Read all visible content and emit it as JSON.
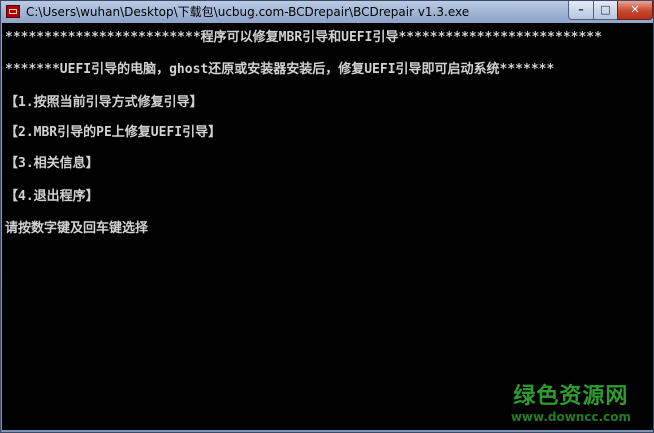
{
  "window": {
    "title": "C:\\Users\\wuhan\\Desktop\\下载包\\ucbug.com-BCDrepair\\BCDrepair v1.3.exe",
    "controls": {
      "minimize": "–",
      "maximize": "□",
      "close": "✕"
    }
  },
  "console": {
    "lines": [
      "*************************程序可以修复MBR引导和UEFI引导**************************",
      "*******UEFI引导的电脑，ghost还原或安装器安装后，修复UEFI引导即可启动系统*******",
      "【1.按照当前引导方式修复引导】",
      "【2.MBR引导的PE上修复UEFI引导】",
      "【3.相关信息】",
      "【4.退出程序】",
      "请按数字键及回车键选择"
    ]
  },
  "watermark": {
    "main": "绿色资源网",
    "url": "www.downcc.com"
  }
}
